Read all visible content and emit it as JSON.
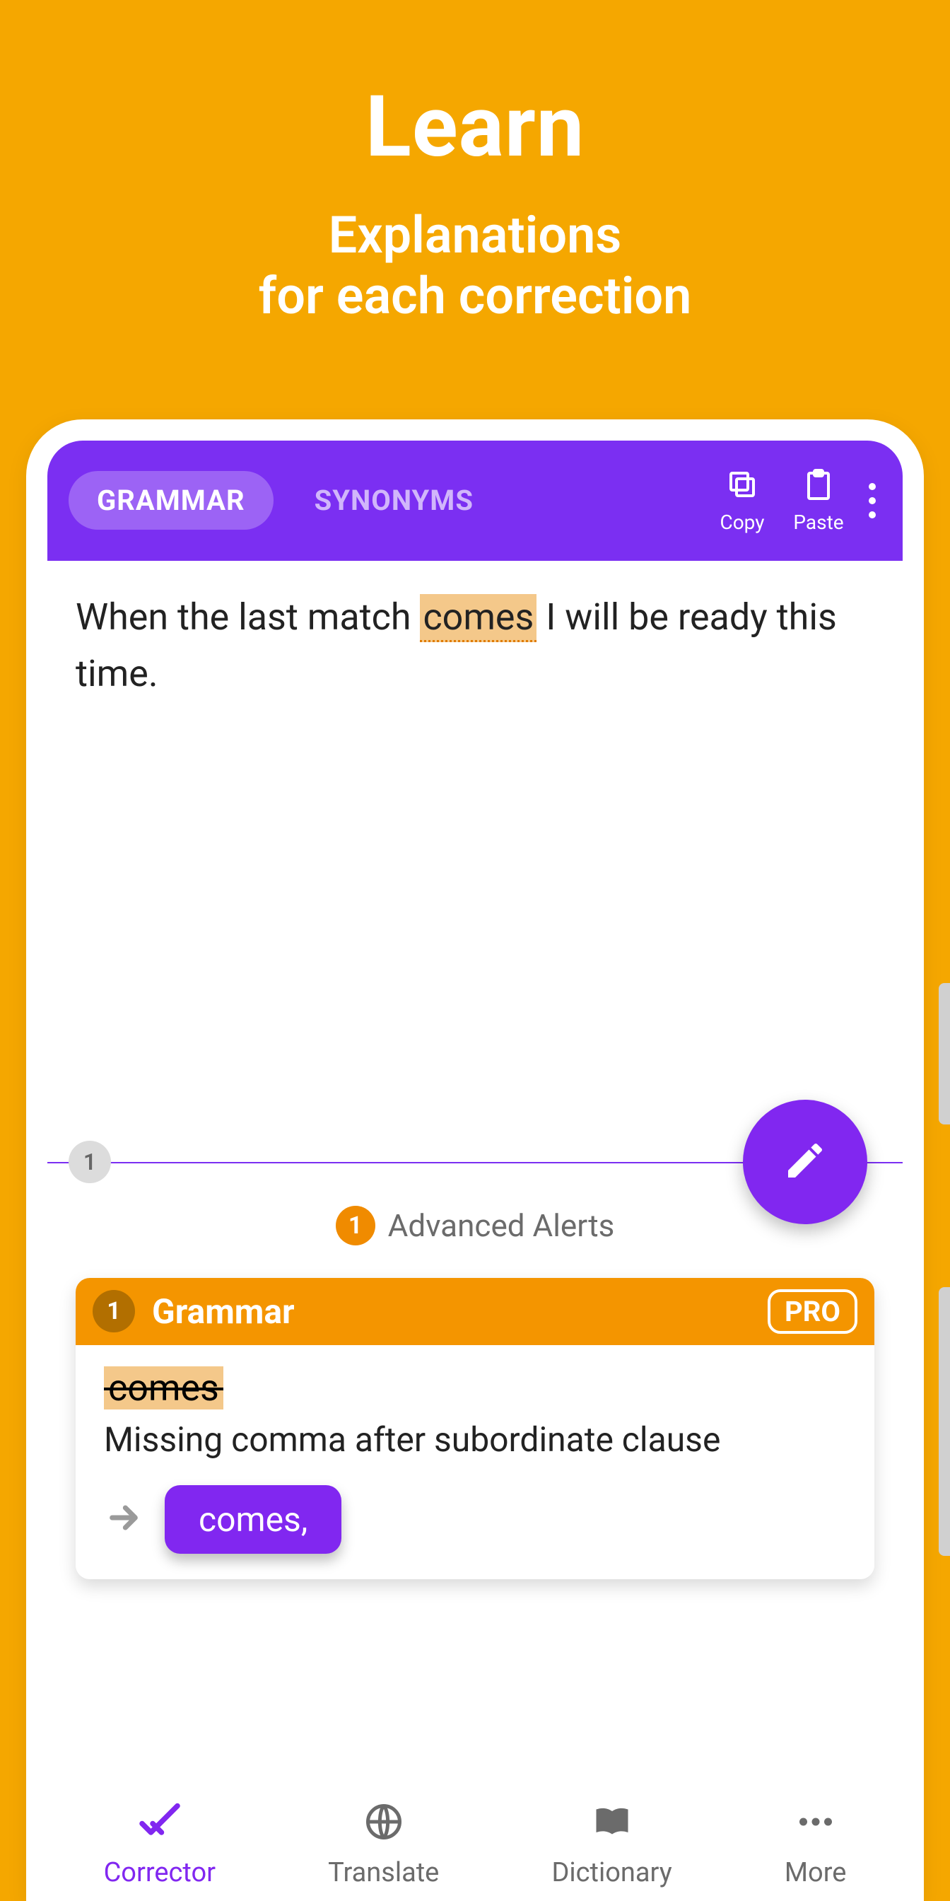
{
  "promo": {
    "title": "Learn",
    "subtitle1": "Explanations",
    "subtitle2": "for each correction"
  },
  "header": {
    "tab_active": "GRAMMAR",
    "tab_inactive": "SYNONYMS",
    "copy_label": "Copy",
    "paste_label": "Paste"
  },
  "editor": {
    "pre": "When the last match ",
    "hl": "comes",
    "post": " I will be ready this time.",
    "issue_count": "1"
  },
  "alerts": {
    "count": "1",
    "label": "Advanced Alerts"
  },
  "card": {
    "num": "1",
    "category": "Grammar",
    "pro": "PRO",
    "orig": "comes",
    "explain": "Missing comma after subordinate clause",
    "suggestion": "comes,"
  },
  "nav": {
    "corrector": "Corrector",
    "translate": "Translate",
    "dictionary": "Dictionary",
    "more": "More"
  }
}
